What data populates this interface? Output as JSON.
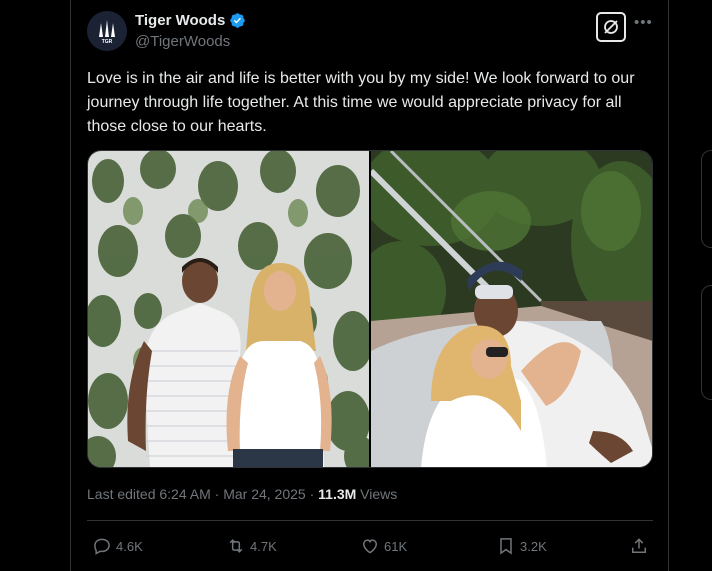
{
  "tweet": {
    "author": {
      "display_name": "Tiger Woods",
      "handle": "@TigerWoods",
      "avatar_text": "TGR"
    },
    "text": "Love is in the air and life is better with you by my side! We look forward to our journey through life together. At this time we would appreciate privacy for all those close to our hearts.",
    "meta": {
      "edited_label": "Last edited 6:24 AM · Mar 24, 2025 · ",
      "views_count": "11.3M",
      "views_label": " Views"
    },
    "actions": {
      "replies": "4.6K",
      "reposts": "4.7K",
      "likes": "61K",
      "bookmarks": "3.2K"
    }
  },
  "colors": {
    "background": "#000000",
    "text": "#e7e9ea",
    "secondary_text": "#71767b",
    "border": "#2f3336",
    "verified": "#1d9bf0"
  },
  "icons": [
    "verified-badge-icon",
    "grok-icon",
    "more-icon",
    "reply-icon",
    "repost-icon",
    "like-icon",
    "bookmark-icon",
    "share-icon"
  ]
}
